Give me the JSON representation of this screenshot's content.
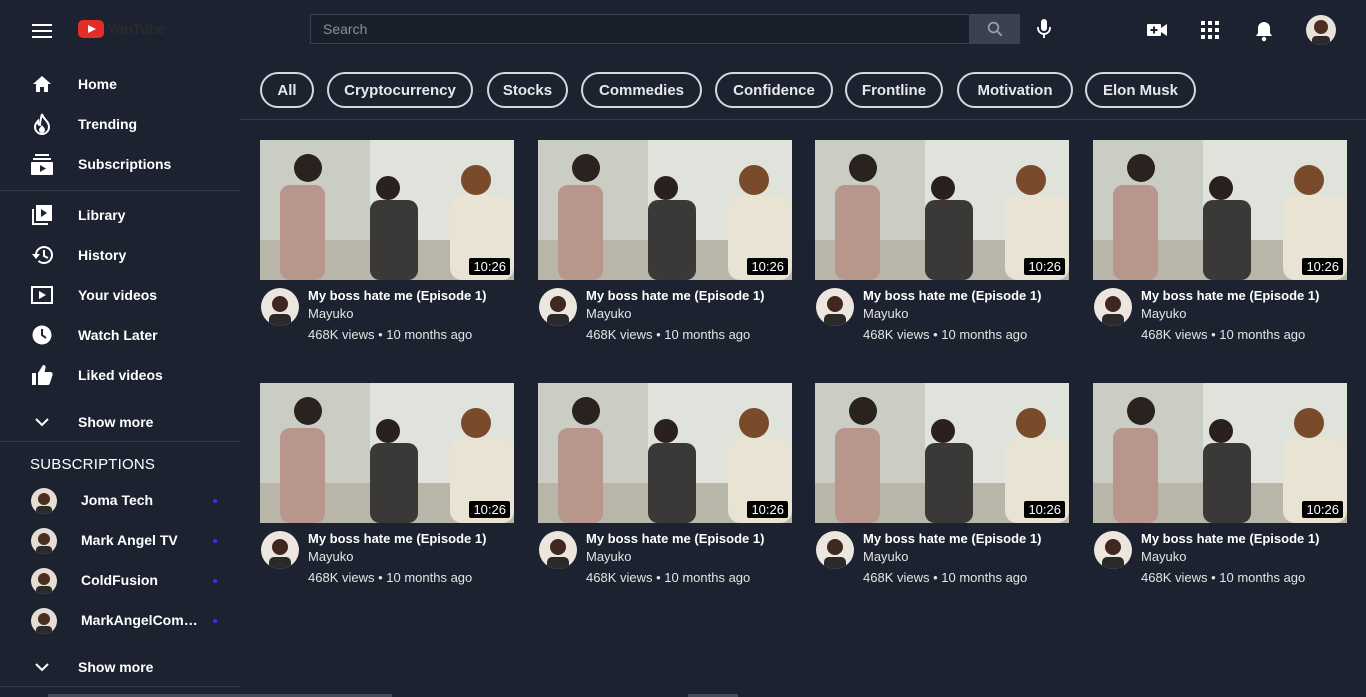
{
  "header": {
    "logo_text": "YouTube",
    "search_placeholder": "Search"
  },
  "sidebar": {
    "main_items": [
      {
        "label": "Home",
        "icon": "home-icon"
      },
      {
        "label": "Trending",
        "icon": "trending-icon"
      },
      {
        "label": "Subscriptions",
        "icon": "subscriptions-icon"
      }
    ],
    "library_items": [
      {
        "label": "Library",
        "icon": "library-icon"
      },
      {
        "label": "History",
        "icon": "history-icon"
      },
      {
        "label": "Your videos",
        "icon": "your-videos-icon"
      },
      {
        "label": "Watch Later",
        "icon": "clock-icon"
      },
      {
        "label": "Liked videos",
        "icon": "thumbs-up-icon"
      }
    ],
    "show_more_label": "Show more",
    "subscriptions_heading": "SUBSCRIPTIONS",
    "subscriptions": [
      {
        "name": "Joma Tech"
      },
      {
        "name": "Mark Angel TV"
      },
      {
        "name": "ColdFusion"
      },
      {
        "name": "MarkAngelComedy"
      }
    ],
    "show_more_label_2": "Show more",
    "new_dot_color": "#2b35ff"
  },
  "chips": [
    "All",
    "Cryptocurrency",
    "Stocks",
    "Commedies",
    "Confidence",
    "Frontline",
    "Motivation",
    "Elon Musk"
  ],
  "videos": [
    {
      "title": "My boss hate me (Episode 1)",
      "channel": "Mayuko",
      "meta": "468K views • 10 months ago",
      "duration": "10:26"
    },
    {
      "title": "My boss hate me (Episode 1)",
      "channel": "Mayuko",
      "meta": "468K views • 10 months ago",
      "duration": "10:26"
    },
    {
      "title": "My boss hate me (Episode 1)",
      "channel": "Mayuko",
      "meta": "468K views • 10 months ago",
      "duration": "10:26"
    },
    {
      "title": "My boss hate me (Episode 1)",
      "channel": "Mayuko",
      "meta": "468K views • 10 months ago",
      "duration": "10:26"
    },
    {
      "title": "My boss hate me (Episode 1)",
      "channel": "Mayuko",
      "meta": "468K views • 10 months ago",
      "duration": "10:26"
    },
    {
      "title": "My boss hate me (Episode 1)",
      "channel": "Mayuko",
      "meta": "468K views • 10 months ago",
      "duration": "10:26"
    },
    {
      "title": "My boss hate me (Episode 1)",
      "channel": "Mayuko",
      "meta": "468K views • 10 months ago",
      "duration": "10:26"
    },
    {
      "title": "My boss hate me (Episode 1)",
      "channel": "Mayuko",
      "meta": "468K views • 10 months ago",
      "duration": "10:26"
    }
  ],
  "colors": {
    "background": "#1c2230",
    "brand_red": "#e52d27",
    "divider": "#343b49"
  }
}
